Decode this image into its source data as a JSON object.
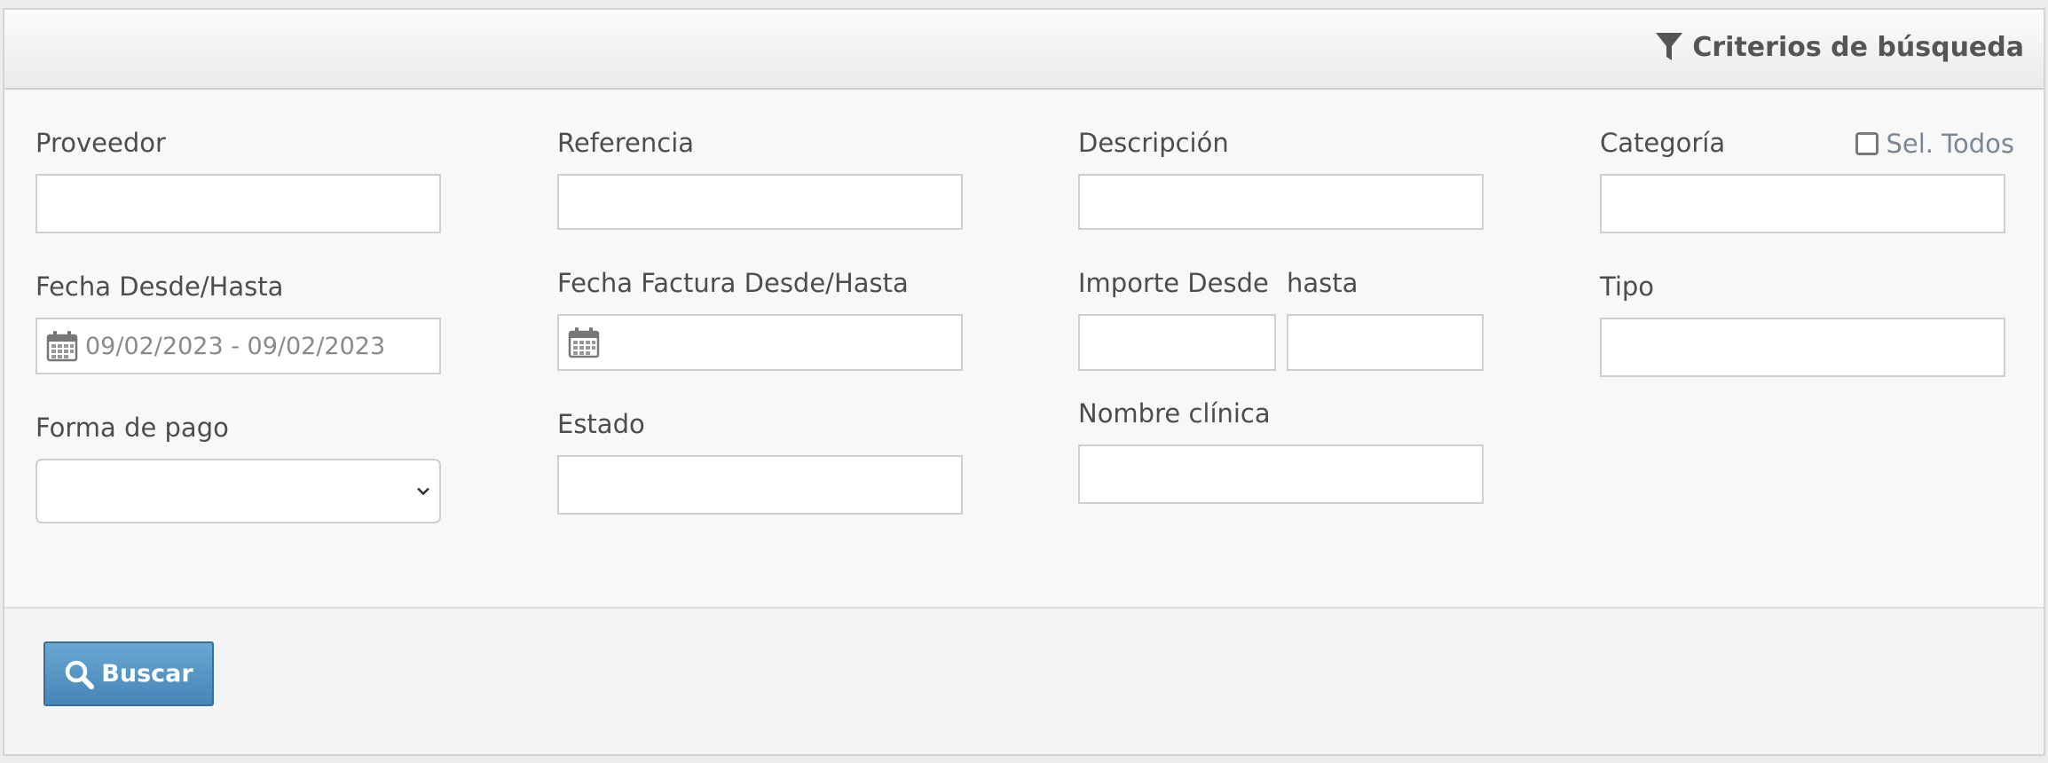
{
  "header": {
    "title": "Criterios de búsqueda",
    "icon": "filter-icon"
  },
  "fields": {
    "proveedor": {
      "label": "Proveedor",
      "value": ""
    },
    "referencia": {
      "label": "Referencia",
      "value": ""
    },
    "descripcion": {
      "label": "Descripción",
      "value": ""
    },
    "categoria": {
      "label": "Categoría",
      "value": "",
      "select_all_label": "Sel. Todos",
      "select_all_checked": false
    },
    "fecha": {
      "label": "Fecha Desde/Hasta",
      "value": "09/02/2023 - 09/02/2023",
      "icon": "calendar-icon"
    },
    "fecha_factura": {
      "label": "Fecha Factura Desde/Hasta",
      "value": "",
      "icon": "calendar-icon"
    },
    "importe_desde": {
      "label": "Importe Desde",
      "value": ""
    },
    "importe_hasta": {
      "label": "hasta",
      "value": ""
    },
    "tipo": {
      "label": "Tipo",
      "value": ""
    },
    "forma_pago": {
      "label": "Forma de pago",
      "selected": ""
    },
    "estado": {
      "label": "Estado",
      "value": ""
    },
    "nombre_clinica": {
      "label": "Nombre clínica",
      "value": ""
    }
  },
  "footer": {
    "search_label": "Buscar",
    "search_icon": "search-icon"
  },
  "colors": {
    "button": "#5593c3",
    "border": "#cfcfcf",
    "panel": "#f8f8f8"
  }
}
